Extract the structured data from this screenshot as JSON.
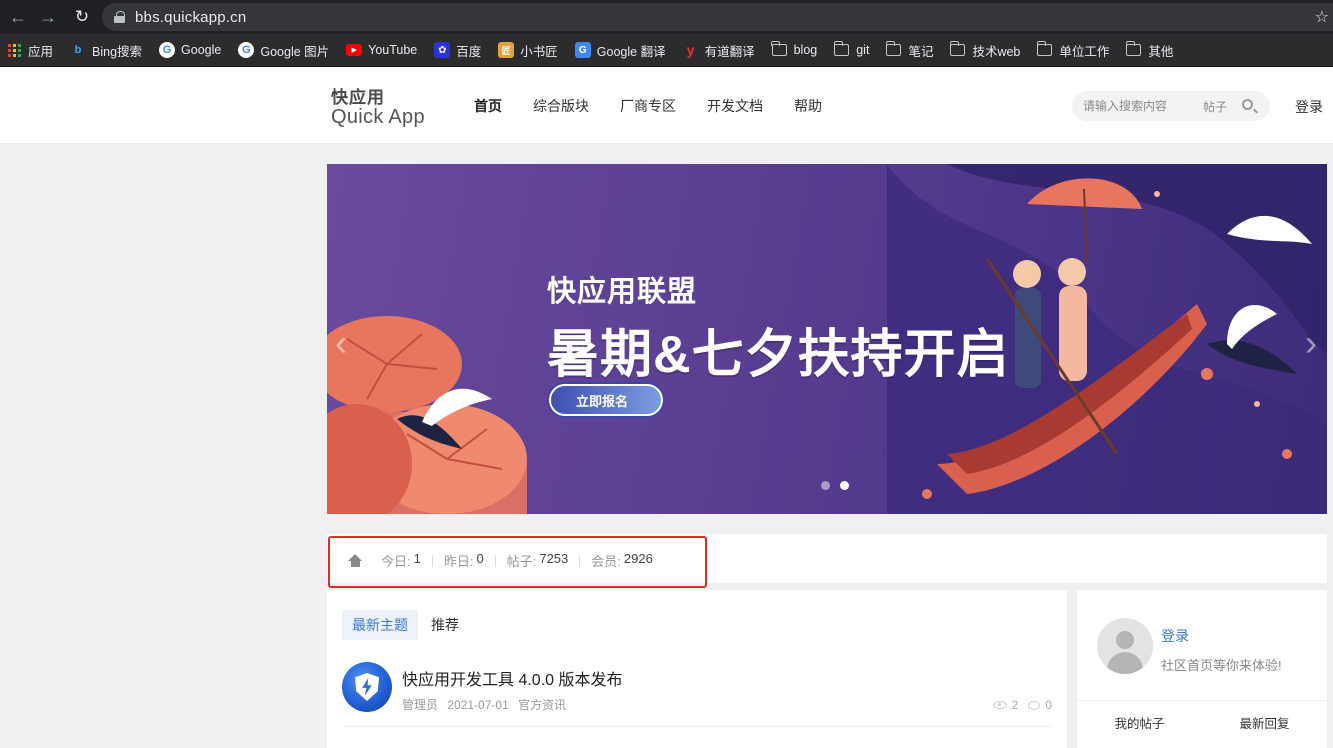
{
  "browser": {
    "url": "bbs.quickapp.cn",
    "bookmarks": [
      "应用",
      "Bing搜索",
      "Google",
      "Google 图片",
      "YouTube",
      "百度",
      "小书匠",
      "Google 翻译",
      "有道翻译",
      "blog",
      "git",
      "笔记",
      "技术web",
      "单位工作",
      "其他"
    ]
  },
  "header": {
    "logo_cn": "快应用",
    "logo_en": "Quick App",
    "nav": [
      "首页",
      "综合版块",
      "厂商专区",
      "开发文档",
      "帮助"
    ],
    "search_placeholder": "请输入搜索内容",
    "search_scope": "帖子",
    "login": "登录"
  },
  "banner": {
    "subtitle": "快应用联盟",
    "title": "暑期&七夕扶持开启",
    "cta": "立即报名",
    "colors": {
      "bg": "#5a3f92",
      "accent": "#e8765f"
    }
  },
  "stats": {
    "today_label": "今日:",
    "today": "1",
    "yesterday_label": "昨日:",
    "yesterday": "0",
    "posts_label": "帖子:",
    "posts": "7253",
    "members_label": "会员:",
    "members": "2926"
  },
  "content": {
    "tabs": [
      "最新主题",
      "推荐"
    ],
    "posts": [
      {
        "title": "快应用开发工具 4.0.0 版本发布",
        "author": "管理员",
        "date": "2021-07-01",
        "category": "官方资讯",
        "views": "2",
        "replies": "0"
      }
    ]
  },
  "side": {
    "login": "登录",
    "tip": "社区首页等你来体验!",
    "tabs": [
      "我的帖子",
      "最新回复"
    ]
  }
}
